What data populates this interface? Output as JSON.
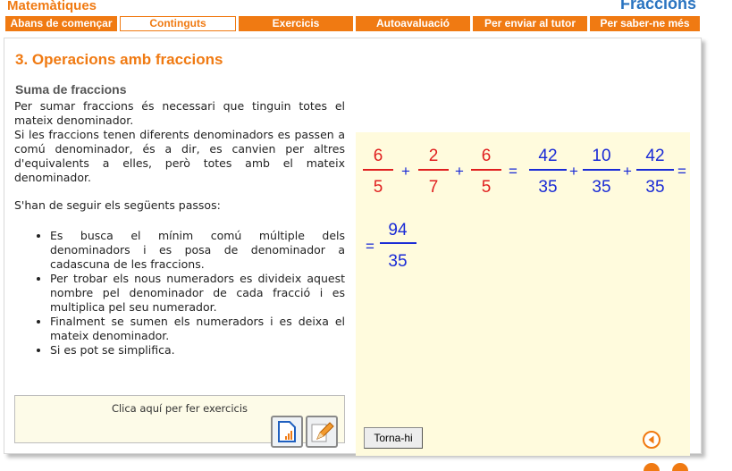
{
  "header": {
    "brand": "Matemàtiques",
    "unit_title": "Fraccions"
  },
  "nav": [
    {
      "label": "Abans de començar",
      "active": false
    },
    {
      "label": "Continguts",
      "active": true
    },
    {
      "label": "Exercicis",
      "active": false
    },
    {
      "label": "Autoavaluació",
      "active": false
    },
    {
      "label": "Per enviar al tutor",
      "active": false
    },
    {
      "label": "Per saber-ne més",
      "active": false
    }
  ],
  "content": {
    "title": "3. Operacions amb fraccions",
    "subtitle": "Suma de fraccions",
    "p1": "Per sumar fraccions és necessari que tinguin totes el mateix denominador.",
    "p2": "Si les fraccions tenen diferents denominadors es passen a comú denominador, és a dir, es canvien per altres d'equivalents a elles, però totes amb el mateix denominador.",
    "p3": "S'han de seguir els següents passos:",
    "steps": [
      "Es busca el mínim comú múltiple dels denominadors i es posa de denominador a cadascuna de les fraccions.",
      "Per trobar els nous numeradors es divideix aquest nombre pel denominador de cada fracció i es multiplica pel seu numerador.",
      "Finalment se sumen els numeradors i es deixa el mateix denominador.",
      "Si es pot se simplifica."
    ],
    "exercise_prompt": "Clica aquí per fer exercicis"
  },
  "math": {
    "row1": [
      {
        "num": "6",
        "den": "5",
        "color": "#e01f1f"
      },
      {
        "num": "2",
        "den": "7",
        "color": "#e01f1f"
      },
      {
        "num": "6",
        "den": "5",
        "color": "#e01f1f"
      },
      {
        "num": "42",
        "den": "35",
        "color": "#1a2bd6"
      },
      {
        "num": "10",
        "den": "35",
        "color": "#1a2bd6"
      },
      {
        "num": "42",
        "den": "35",
        "color": "#1a2bd6"
      }
    ],
    "ops": [
      "+",
      "+",
      "=",
      "+",
      "+",
      "="
    ],
    "result": {
      "eq": "=",
      "num": "94",
      "den": "35",
      "color": "#1a2bd6"
    },
    "back_label": "Torna-hi"
  },
  "colors": {
    "brand": "#f07a12",
    "blue": "#1a2bd6",
    "red": "#e01f1f",
    "yellow_panel": "#fffbdd"
  },
  "icons": [
    "chart-icon",
    "pencil-icon",
    "back-arrow-icon"
  ]
}
